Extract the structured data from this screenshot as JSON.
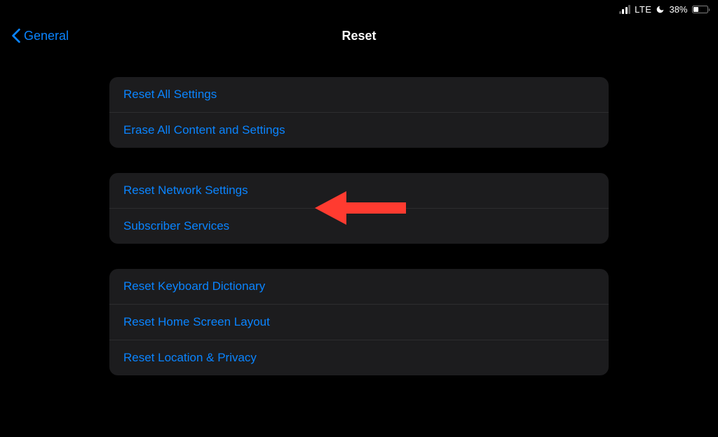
{
  "statusBar": {
    "network": "LTE",
    "batteryPercent": "38%"
  },
  "nav": {
    "backLabel": "General",
    "title": "Reset"
  },
  "groups": [
    {
      "rows": [
        {
          "label": "Reset All Settings"
        },
        {
          "label": "Erase All Content and Settings"
        }
      ]
    },
    {
      "rows": [
        {
          "label": "Reset Network Settings"
        },
        {
          "label": "Subscriber Services"
        }
      ]
    },
    {
      "rows": [
        {
          "label": "Reset Keyboard Dictionary"
        },
        {
          "label": "Reset Home Screen Layout"
        },
        {
          "label": "Reset Location & Privacy"
        }
      ]
    }
  ]
}
